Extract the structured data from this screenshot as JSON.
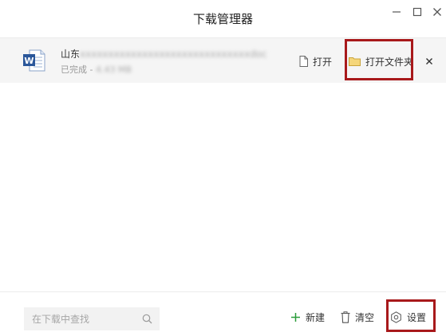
{
  "window": {
    "title": "下载管理器",
    "controls": {
      "minimize": "minimize-icon",
      "maximize": "maximize-icon",
      "close": "close-icon"
    }
  },
  "download_item": {
    "file_name_start": "山东",
    "file_name_obscured": "xxxxxxxxxxxxxxxxxxxxxxxxxxxxxx",
    "file_name_end": "doc",
    "status_prefix": "已完成 - ",
    "status_size_obscured": "4.43 MB",
    "icon": "word-document-icon",
    "actions": {
      "open_label": "打开",
      "open_folder_label": "打开文件夹"
    }
  },
  "bottom": {
    "search_placeholder": "在下载中查找",
    "new_label": "新建",
    "clear_label": "清空",
    "settings_label": "设置"
  },
  "colors": {
    "highlight": "#a8191b",
    "word_blue": "#2b579a",
    "folder_yellow": "#f5d67a",
    "row_background": "#f5f5f5",
    "plus_green": "#2a9c3a"
  }
}
